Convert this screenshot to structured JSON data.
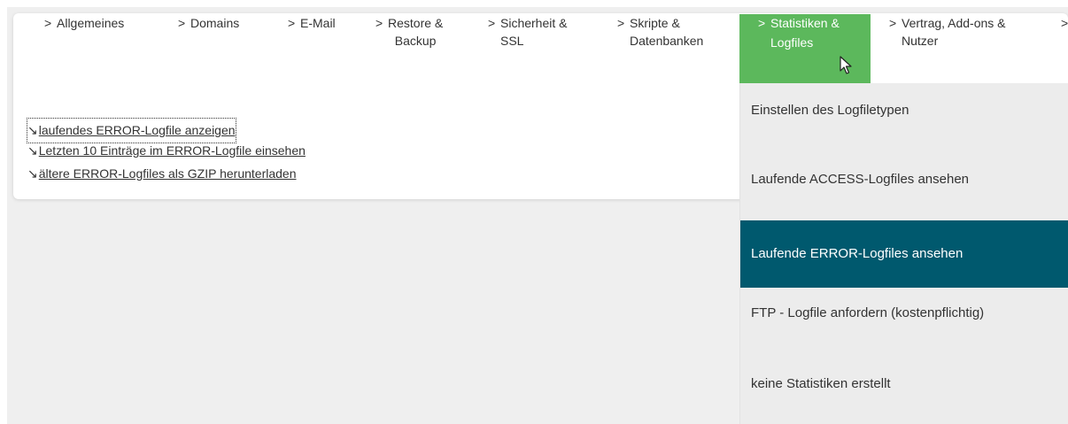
{
  "nav": {
    "items": [
      {
        "lines": [
          "Allgemeines"
        ]
      },
      {
        "lines": [
          "Domains"
        ]
      },
      {
        "lines": [
          "E-Mail"
        ]
      },
      {
        "lines": [
          "Restore &",
          "Backup"
        ]
      },
      {
        "lines": [
          "Sicherheit &",
          "SSL"
        ]
      },
      {
        "lines": [
          "Skripte &",
          "Datenbanken"
        ]
      },
      {
        "lines": [
          "Statistiken &",
          "Logfiles"
        ],
        "active": true
      },
      {
        "lines": [
          "Vertrag, Add-ons &",
          "Nutzer"
        ]
      }
    ],
    "chevron": ">",
    "overflow_chevron": ">",
    "active_color": "#5cb85c"
  },
  "links": [
    {
      "arrow": "↘",
      "label": "laufendes ERROR-Logfile anzeigen"
    },
    {
      "arrow": "↘",
      "label": "Letzten 10 Einträge im ERROR-Logfile einsehen"
    },
    {
      "arrow": "↘",
      "label": "ältere ERROR-Logfiles als GZIP herunterladen"
    }
  ],
  "dropdown": {
    "items": [
      {
        "label": "Einstellen des Logfiletypen"
      },
      {
        "label": "Laufende ACCESS-Logfiles ansehen"
      },
      {
        "label": "Laufende ERROR-Logfiles ansehen",
        "active": true
      },
      {
        "label": "FTP - Logfile anfordern (kostenpflichtig)"
      },
      {
        "label": "keine Statistiken erstellt"
      }
    ],
    "active_color": "#00596e"
  },
  "icons": {
    "cursor": "mouse-pointer-icon",
    "link_arrow": "south-east-arrow-icon"
  }
}
